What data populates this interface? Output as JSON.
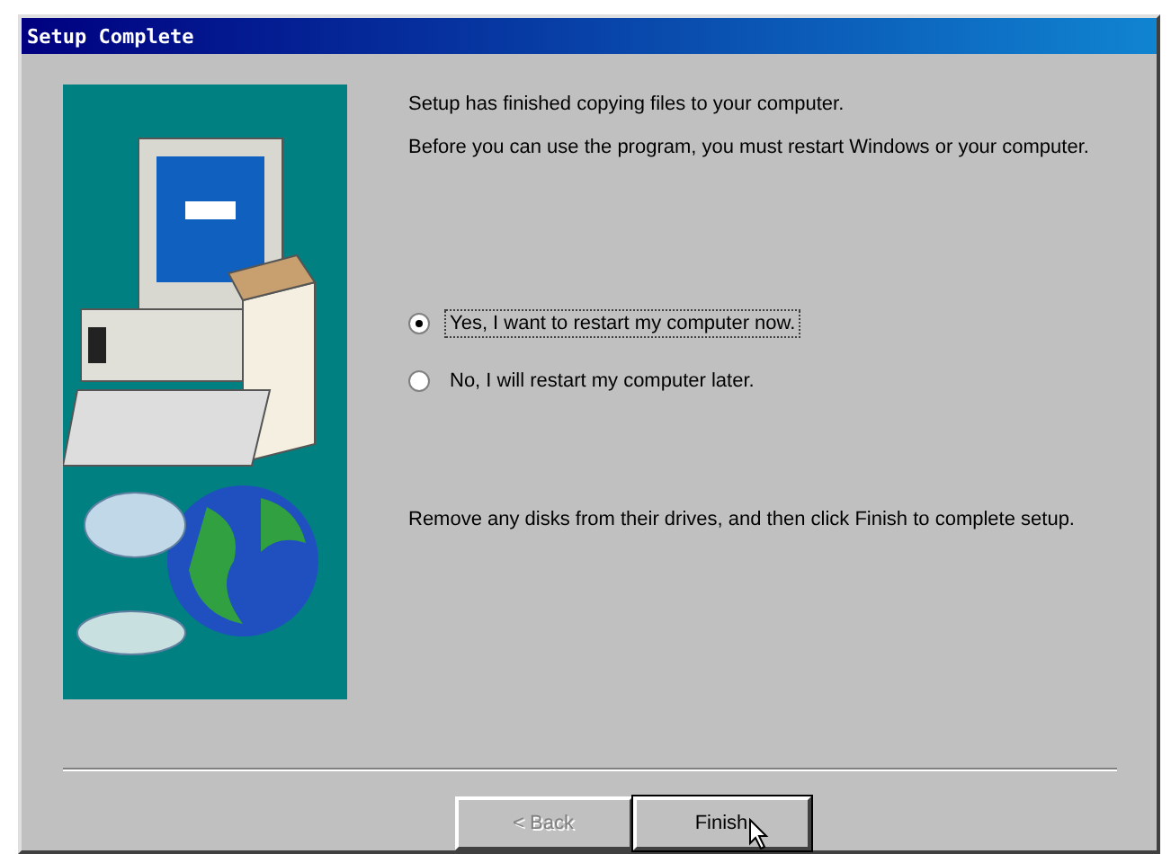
{
  "window": {
    "title": "Setup Complete"
  },
  "messages": [
    "Setup has finished copying files to your computer.",
    "Before you can use the program, you must restart Windows or your computer."
  ],
  "options": [
    {
      "label": "Yes, I want to restart my computer now.",
      "selected": true
    },
    {
      "label": "No, I will restart my computer later.",
      "selected": false
    }
  ],
  "note": "Remove any disks from their drives, and then click Finish to complete setup.",
  "buttons": [
    {
      "label": "< Back",
      "disabled": true
    },
    {
      "label": "Finish",
      "disabled": false
    }
  ]
}
